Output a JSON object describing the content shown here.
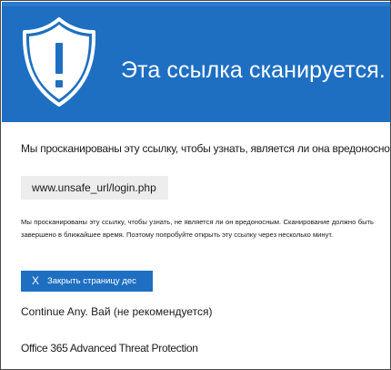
{
  "banner": {
    "title": "Эта ссылка сканируется.",
    "icon": "shield-warning-icon",
    "background_color": "#1e6fc2"
  },
  "message": {
    "lead": "Мы просканированы эту ссылку, чтобы узнать, является ли она вредоносной.",
    "url": "www.unsafe_url/login.php",
    "detail": "Мы просканированы эту ссылку, чтобы узнать, не является ли он вредоносным. Сканирование должно быть завершено в ближайшее время. Поэтому попробуйте открыть эту ссылку через несколько минут."
  },
  "actions": {
    "close_icon": "close-icon",
    "close_glyph": "X",
    "close_label": "Закрыть страницу дес",
    "continue_label": "Continue Any. Вай (не рекомендуется)"
  },
  "footer": {
    "product": "Office 365 Advanced Threat Protection"
  }
}
